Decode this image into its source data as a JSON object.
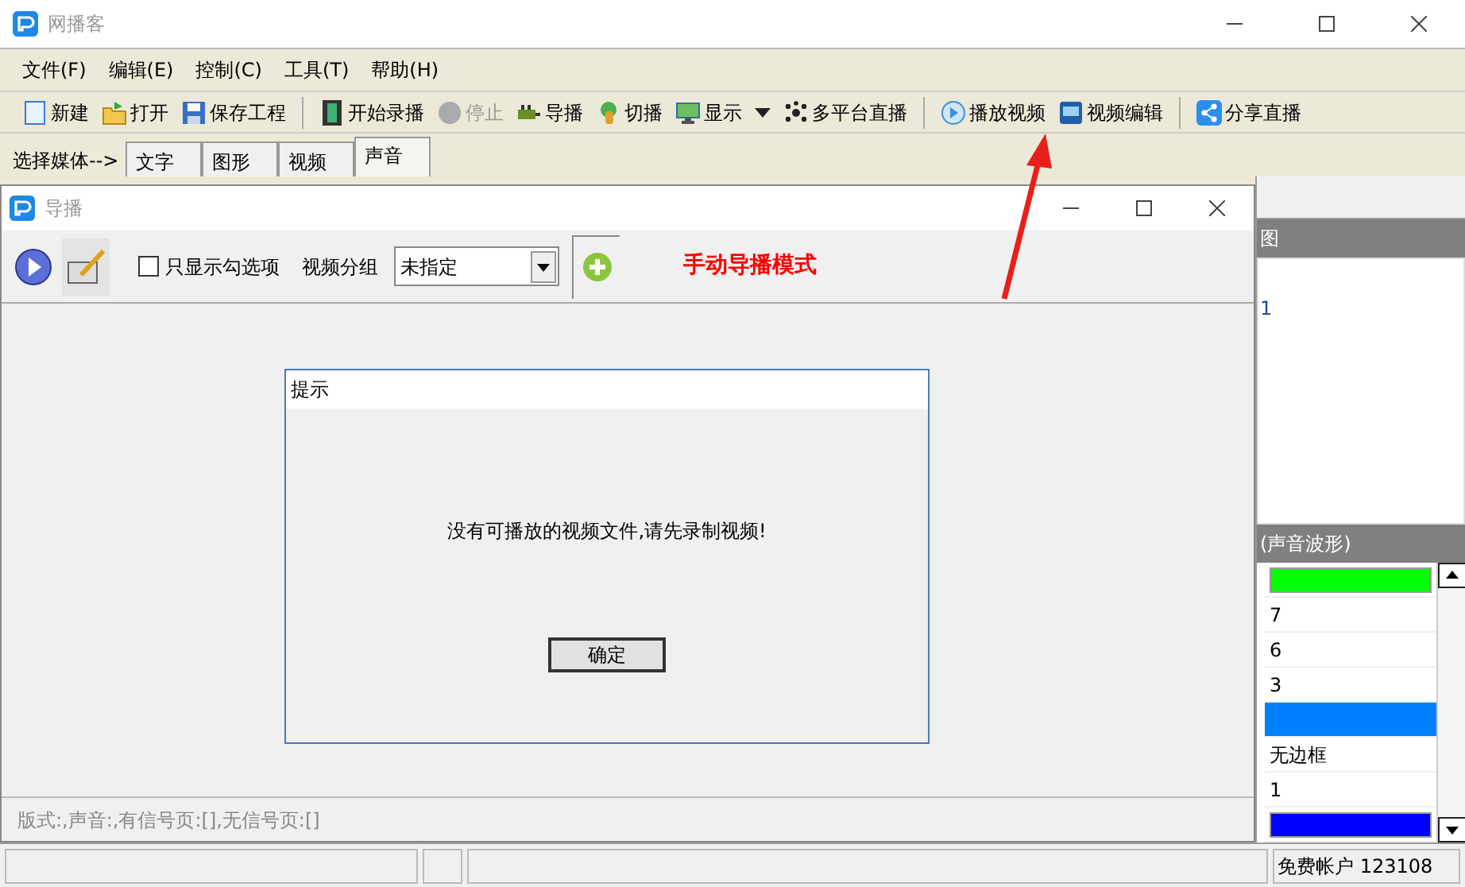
{
  "window": {
    "title": "网播客"
  },
  "menu": [
    {
      "label": "文件(F)"
    },
    {
      "label": "编辑(E)"
    },
    {
      "label": "控制(C)"
    },
    {
      "label": "工具(T)"
    },
    {
      "label": "帮助(H)"
    }
  ],
  "toolbar": [
    [
      {
        "label": "新建",
        "kind": "new",
        "disabled": false
      },
      {
        "label": "打开",
        "kind": "open",
        "disabled": false
      },
      {
        "label": "保存工程",
        "kind": "save",
        "disabled": false
      }
    ],
    [
      {
        "label": "开始录播",
        "kind": "film",
        "disabled": false
      },
      {
        "label": "停止",
        "kind": "stop",
        "disabled": true
      },
      {
        "label": "导播",
        "kind": "director",
        "disabled": false
      },
      {
        "label": "切播",
        "kind": "switch",
        "disabled": false
      },
      {
        "label": "显示",
        "kind": "display",
        "disabled": false,
        "dropdown": true
      },
      {
        "label": "多平台直播",
        "kind": "multi",
        "disabled": false
      }
    ],
    [
      {
        "label": "播放视频",
        "kind": "play",
        "disabled": false
      },
      {
        "label": "视频编辑",
        "kind": "edit",
        "disabled": false
      }
    ],
    [
      {
        "label": "分享直播",
        "kind": "share",
        "disabled": false
      }
    ]
  ],
  "media_label": "选择媒体-->",
  "tabs": [
    {
      "label": "文字",
      "selected": false
    },
    {
      "label": "图形",
      "selected": false
    },
    {
      "label": "视频",
      "selected": false
    },
    {
      "label": "声音",
      "selected": true
    }
  ],
  "dialog": {
    "title": "导播",
    "filter": {
      "label": "只显示勾选项",
      "checked": false
    },
    "group_label": "视频分组",
    "group_select": "未指定",
    "mode": "手动导播模式",
    "message_box": {
      "title": "提示",
      "message": "没有可播放的视频文件,请先录制视频!",
      "button": "确定"
    },
    "footer": "版式:,声音:,有信号页:[],无信号页:[]"
  },
  "view_panel": {
    "header": "图",
    "items": [
      "1"
    ]
  },
  "properties": {
    "header": "(声音波形)",
    "rows": [
      {
        "kind": "swatch",
        "color": "#00ff00",
        "selected": false
      },
      {
        "kind": "text",
        "value": "7",
        "selected": false
      },
      {
        "kind": "text",
        "value": "6",
        "selected": false
      },
      {
        "kind": "text",
        "value": "3",
        "selected": false
      },
      {
        "kind": "blank",
        "selected": true
      },
      {
        "kind": "text",
        "value": "无边框",
        "selected": false
      },
      {
        "kind": "text",
        "value": "1",
        "selected": false
      },
      {
        "kind": "swatch",
        "color": "#0000ff",
        "selected": false
      }
    ]
  },
  "status_bar": {
    "account": "免费帐户 123108"
  }
}
